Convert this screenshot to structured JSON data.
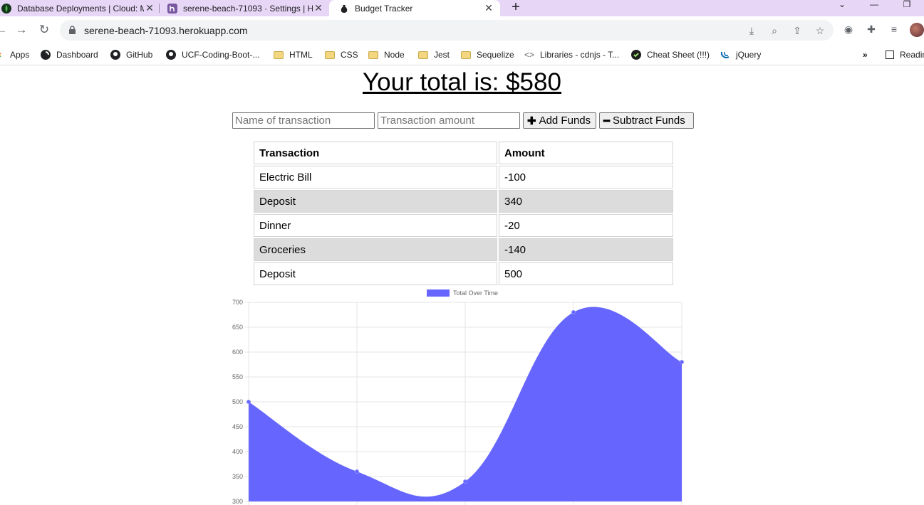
{
  "browser": {
    "tabs": [
      {
        "title": "Database Deployments | Cloud: M",
        "icon": "mongodb-leaf-icon"
      },
      {
        "title": "serene-beach-71093 · Settings | H",
        "icon": "heroku-icon"
      },
      {
        "title": "Budget Tracker",
        "icon": "money-bag-icon"
      }
    ],
    "url": "serene-beach-71093.herokuapp.com",
    "bookmarks": [
      {
        "label": "Apps",
        "icon": "apps-grid-icon"
      },
      {
        "label": "Dashboard",
        "icon": "dashboard-icon"
      },
      {
        "label": "GitHub",
        "icon": "github-icon"
      },
      {
        "label": "UCF-Coding-Boot-...",
        "icon": "github-icon"
      },
      {
        "label": "HTML",
        "icon": "folder-icon"
      },
      {
        "label": "CSS",
        "icon": "folder-icon"
      },
      {
        "label": "Node",
        "icon": "folder-icon"
      },
      {
        "label": "Jest",
        "icon": "folder-icon"
      },
      {
        "label": "Sequelize",
        "icon": "folder-icon"
      },
      {
        "label": "Libraries - cdnjs - T...",
        "icon": "code-icon"
      },
      {
        "label": "Cheat Sheet (!!!)",
        "icon": "cheatsheet-icon"
      },
      {
        "label": "jQuery",
        "icon": "jquery-icon"
      }
    ],
    "reading_list": "Readin"
  },
  "page": {
    "total_prefix": "Your total is: $",
    "total_value": "580",
    "name_placeholder": "Name of transaction",
    "amount_placeholder": "Transaction amount",
    "add_label": "Add Funds",
    "subtract_label": "Subtract Funds",
    "table": {
      "headers": [
        "Transaction",
        "Amount"
      ],
      "rows": [
        [
          "Electric Bill",
          "-100"
        ],
        [
          "Deposit",
          "340"
        ],
        [
          "Dinner",
          "-20"
        ],
        [
          "Groceries",
          "-140"
        ],
        [
          "Deposit",
          "500"
        ]
      ]
    }
  },
  "chart_data": {
    "type": "area",
    "series": [
      {
        "name": "Total Over Time",
        "values": [
          500,
          360,
          340,
          680,
          580
        ],
        "color": "#6666ff"
      }
    ],
    "ylim": [
      300,
      700
    ],
    "yticks": [
      700,
      650,
      600,
      550,
      500,
      450,
      400,
      350,
      300
    ],
    "legend": "top",
    "grid": true
  }
}
